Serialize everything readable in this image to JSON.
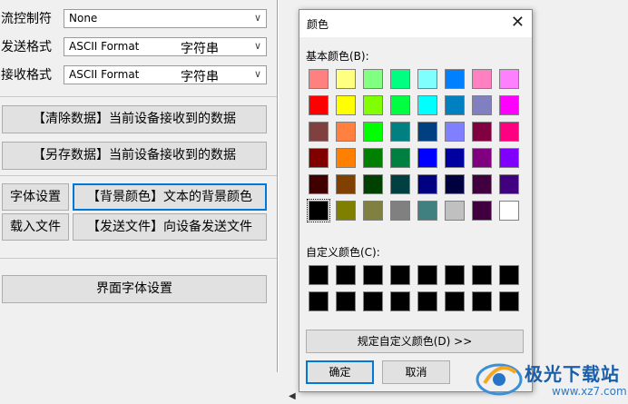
{
  "settings": {
    "flow_control": {
      "label": "流控制符",
      "value": "None"
    },
    "send_format": {
      "label": "发送格式",
      "value": "ASCII Format",
      "mode": "字符串"
    },
    "recv_format": {
      "label": "接收格式",
      "value": "ASCII Format",
      "mode": "字符串"
    }
  },
  "buttons": {
    "clear_data": "【清除数据】当前设备接收到的数据",
    "save_data": "【另存数据】当前设备接收到的数据",
    "font_settings": "字体设置",
    "bg_color": "【背景颜色】文本的背景颜色",
    "load_file": "载入文件",
    "send_file": "【发送文件】向设备发送文件",
    "ui_font": "界面字体设置"
  },
  "dialog": {
    "title": "颜色",
    "basic_colors_label": "基本颜色(B):",
    "custom_colors_label": "自定义颜色(C):",
    "define_custom_label": "规定自定义颜色(D) >>",
    "ok_label": "确定",
    "cancel_label": "取消",
    "basic_colors": [
      [
        "#ff8080",
        "#ffff80",
        "#80ff80",
        "#00ff80",
        "#80ffff",
        "#0080ff",
        "#ff80c0",
        "#ff80ff"
      ],
      [
        "#ff0000",
        "#ffff00",
        "#80ff00",
        "#00ff40",
        "#00ffff",
        "#0080c0",
        "#8080c0",
        "#ff00ff"
      ],
      [
        "#804040",
        "#ff8040",
        "#00ff00",
        "#008080",
        "#004080",
        "#8080ff",
        "#800040",
        "#ff0080"
      ],
      [
        "#800000",
        "#ff8000",
        "#008000",
        "#008040",
        "#0000ff",
        "#0000a0",
        "#800080",
        "#8000ff"
      ],
      [
        "#400000",
        "#804000",
        "#004000",
        "#004040",
        "#000080",
        "#000040",
        "#400040",
        "#400080"
      ],
      [
        "#000000",
        "#808000",
        "#808040",
        "#808080",
        "#408080",
        "#c0c0c0",
        "#400040",
        "#ffffff"
      ]
    ],
    "selected_color": "#000000",
    "custom_colors": [
      [
        "#000000",
        "#000000",
        "#000000",
        "#000000",
        "#000000",
        "#000000",
        "#000000",
        "#000000"
      ],
      [
        "#000000",
        "#000000",
        "#000000",
        "#000000",
        "#000000",
        "#000000",
        "#000000",
        "#000000"
      ]
    ]
  },
  "watermark": {
    "text": "极光下载站",
    "url": "www.xz7.com"
  }
}
